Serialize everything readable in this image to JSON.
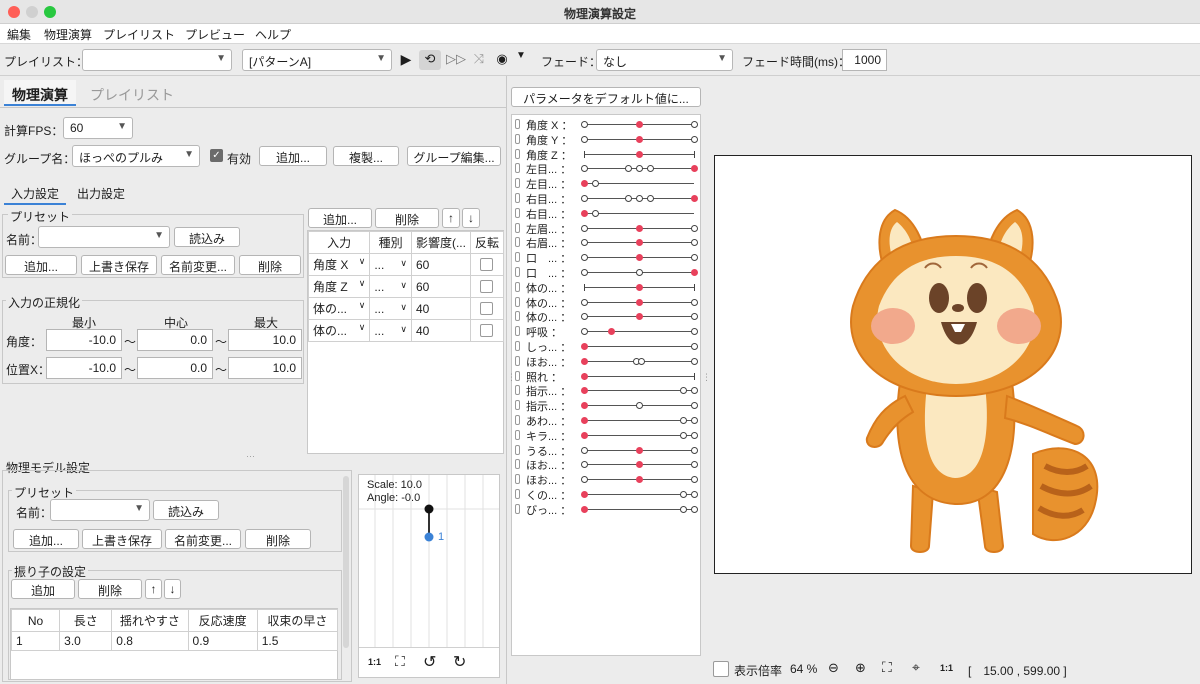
{
  "window": {
    "title": "物理演算設定"
  },
  "menu": [
    "編集",
    "物理演算",
    "プレイリスト",
    "プレビュー",
    "ヘルプ"
  ],
  "toolbar": {
    "playlist_label": "プレイリスト：",
    "playlist_value": "",
    "pattern_value": "[パターンA]",
    "fade_label": "フェード：",
    "fade_value": "なし",
    "fade_time_label": "フェード時間(ms)：",
    "fade_time_value": "1000"
  },
  "left_tabs": [
    "物理演算",
    "プレイリスト"
  ],
  "fps": {
    "label": "計算FPS：",
    "value": "60"
  },
  "group": {
    "label": "グループ名：",
    "value": "ほっぺのプルみ",
    "enabled_label": "有効",
    "add": "追加...",
    "duplicate": "複製...",
    "edit": "グループ編集..."
  },
  "sub_tabs": [
    "入力設定",
    "出力設定"
  ],
  "preset": {
    "title": "プリセット",
    "name_label": "名前：",
    "load": "読込み",
    "add": "追加...",
    "overwrite": "上書き保存",
    "rename": "名前変更...",
    "delete": "削除"
  },
  "normalize": {
    "title": "入力の正規化",
    "headers": [
      "最小",
      "中心",
      "最大"
    ],
    "rows": [
      {
        "label": "角度：",
        "min": "-10.0",
        "center": "0.0",
        "max": "10.0"
      },
      {
        "label": "位置X：",
        "min": "-10.0",
        "center": "0.0",
        "max": "10.0"
      }
    ],
    "sep": "〜"
  },
  "input_table": {
    "add": "追加...",
    "delete": "削除",
    "up": "↑",
    "down": "↓",
    "headers": [
      "入力",
      "種別",
      "影響度(...",
      "反転"
    ],
    "rows": [
      {
        "input": "角度 X",
        "type": "...",
        "influence": "60"
      },
      {
        "input": "角度 Z",
        "type": "...",
        "influence": "60"
      },
      {
        "input": "体の...",
        "type": "...",
        "influence": "40"
      },
      {
        "input": "体の...",
        "type": "...",
        "influence": "40"
      }
    ]
  },
  "model": {
    "title": "物理モデル設定",
    "preset_title": "プリセット",
    "name_label": "名前：",
    "load": "読込み",
    "add": "追加...",
    "overwrite": "上書き保存",
    "rename": "名前変更...",
    "delete": "削除",
    "pendulum_title": "振り子の設定",
    "p_add": "追加",
    "p_delete": "削除",
    "up": "↑",
    "down": "↓",
    "headers": [
      "No",
      "長さ",
      "揺れやすさ",
      "反応速度",
      "収束の早さ"
    ],
    "rows": [
      {
        "no": "1",
        "len": "3.0",
        "sway": "0.8",
        "speed": "0.9",
        "conv": "1.5"
      }
    ],
    "scale": "Scale: 10.0",
    "angle": "Angle: -0.0",
    "node_label": "1",
    "one_to_one": "1:1"
  },
  "params_button": "パラメータをデフォルト値に...",
  "params": [
    {
      "name": "角度 X",
      "points": [
        0,
        0.5,
        1
      ],
      "red": [
        1
      ]
    },
    {
      "name": "角度 Y",
      "points": [
        0,
        0.5,
        1
      ],
      "red": [
        1
      ]
    },
    {
      "name": "角度 Z",
      "points": [
        0,
        0.5,
        1
      ],
      "red": [
        1
      ],
      "ticks": true
    },
    {
      "name": "左目...",
      "points": [
        0,
        0.4,
        0.5,
        0.6,
        1
      ],
      "red": [
        4
      ]
    },
    {
      "name": "左目...",
      "points": [
        0,
        0.1
      ],
      "red": [
        0
      ]
    },
    {
      "name": "右目...",
      "points": [
        0,
        0.4,
        0.5,
        0.6,
        1
      ],
      "red": [
        4
      ]
    },
    {
      "name": "右目...",
      "points": [
        0,
        0.1
      ],
      "red": [
        0
      ]
    },
    {
      "name": "左眉...",
      "points": [
        0,
        0.5,
        1
      ],
      "red": [
        1
      ]
    },
    {
      "name": "右眉...",
      "points": [
        0,
        0.5,
        1
      ],
      "red": [
        1
      ]
    },
    {
      "name": "口　...",
      "points": [
        0,
        0.5,
        1
      ],
      "red": [
        1
      ]
    },
    {
      "name": "口　...",
      "points": [
        0,
        0.5,
        1
      ],
      "red": [
        2
      ]
    },
    {
      "name": "体の...",
      "points": [
        0,
        0.5,
        1
      ],
      "red": [
        1
      ],
      "ticks": true
    },
    {
      "name": "体の...",
      "points": [
        0,
        0.5,
        1
      ],
      "red": [
        1
      ]
    },
    {
      "name": "体の...",
      "points": [
        0,
        0.5,
        1
      ],
      "red": [
        1
      ]
    },
    {
      "name": "呼吸",
      "points": [
        0,
        0.25,
        1
      ],
      "red": [
        1
      ]
    },
    {
      "name": "しっ...",
      "points": [
        0,
        1
      ],
      "red": [
        0
      ]
    },
    {
      "name": "ほお...",
      "points": [
        0,
        0.48,
        0.52,
        1
      ],
      "red": [
        0
      ]
    },
    {
      "name": "照れ",
      "points": [
        0,
        1
      ],
      "red": [
        0
      ],
      "ticks": true
    },
    {
      "name": "指示...",
      "points": [
        0,
        0.9,
        1
      ],
      "red": [
        0
      ]
    },
    {
      "name": "指示...",
      "points": [
        0,
        0.5,
        1
      ],
      "red": [
        0
      ]
    },
    {
      "name": "あわ...",
      "points": [
        0,
        0.9,
        1
      ],
      "red": [
        0
      ]
    },
    {
      "name": "キラ...",
      "points": [
        0,
        0.9,
        1
      ],
      "red": [
        0
      ]
    },
    {
      "name": "うる...",
      "points": [
        0,
        0.5,
        1
      ],
      "red": [
        1
      ]
    },
    {
      "name": "ほお...",
      "points": [
        0,
        0.5,
        1
      ],
      "red": [
        1
      ]
    },
    {
      "name": "ほお...",
      "points": [
        0,
        0.5,
        1
      ],
      "red": [
        1
      ]
    },
    {
      "name": "くの...",
      "points": [
        0,
        0.9,
        1
      ],
      "red": [
        0
      ]
    },
    {
      "name": "びっ...",
      "points": [
        0,
        0.9,
        1
      ],
      "red": [
        0
      ]
    }
  ],
  "statusbar": {
    "zoom_label": "表示倍率",
    "zoom": "64 %",
    "one_to_one": "1:1",
    "coords": "[　15.00 , 599.00 ]"
  },
  "colors": {
    "accent": "#3b82d6",
    "red": "#e8415c",
    "squirrel_orange": "#e8922e",
    "squirrel_cream": "#fbe8c0"
  }
}
